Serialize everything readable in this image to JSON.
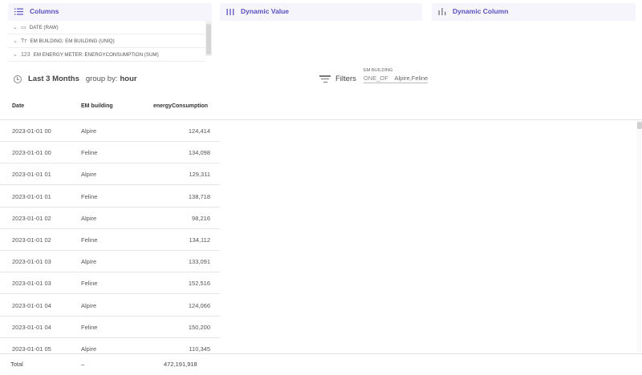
{
  "panels": {
    "columns": {
      "title": "Columns",
      "items": [
        {
          "type_icon": "▭",
          "label": "DATE (RAW)"
        },
        {
          "type_icon": "Tт",
          "label": "EM BUILDING: EM BUILDING (UNIQ)"
        },
        {
          "type_icon": "123",
          "label": "EM ENERGY METER: ENERGYCONSUMPTION (SUM)"
        }
      ]
    },
    "dynamic_value": {
      "title": "Dynamic Value"
    },
    "dynamic_column": {
      "title": "Dynamic Column"
    }
  },
  "toolbar": {
    "range_label": "Last 3 Months",
    "group_by_label": "group by:",
    "group_by_value": "hour",
    "filters_label": "Filters",
    "filter": {
      "field": "EM BUILDING",
      "operator": "ONE_OF",
      "value": "Alpire,Feline"
    }
  },
  "table": {
    "headers": {
      "date": "Date",
      "building": "EM building",
      "value": "energyConsumption"
    },
    "rows": [
      {
        "date": "2023-01-01 00",
        "building": "Alpire",
        "value": "124,414"
      },
      {
        "date": "2023-01-01 00",
        "building": "Feline",
        "value": "134,098"
      },
      {
        "date": "2023-01-01 01",
        "building": "Alpire",
        "value": "129,311"
      },
      {
        "date": "2023-01-01 01",
        "building": "Feline",
        "value": "138,718"
      },
      {
        "date": "2023-01-01 02",
        "building": "Alpire",
        "value": "98,216"
      },
      {
        "date": "2023-01-01 02",
        "building": "Feline",
        "value": "134,112"
      },
      {
        "date": "2023-01-01 03",
        "building": "Alpire",
        "value": "133,091"
      },
      {
        "date": "2023-01-01 03",
        "building": "Feline",
        "value": "152,516"
      },
      {
        "date": "2023-01-01 04",
        "building": "Alpire",
        "value": "124,066"
      },
      {
        "date": "2023-01-01 04",
        "building": "Feline",
        "value": "150,200"
      },
      {
        "date": "2023-01-01 05",
        "building": "Alpire",
        "value": "110,345"
      }
    ],
    "footer": {
      "label": "Total",
      "building": "–",
      "value": "472,191,918"
    }
  }
}
